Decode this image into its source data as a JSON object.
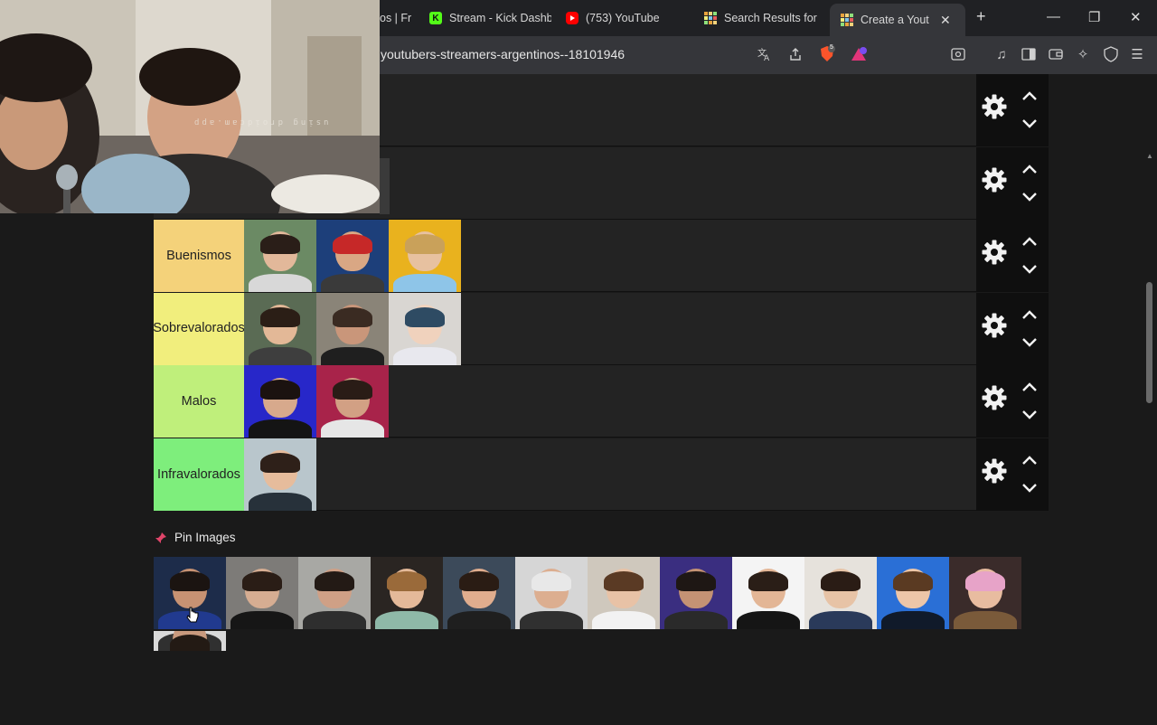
{
  "browser": {
    "tabs": [
      {
        "label": "os | Fr",
        "icon": "generic-tab-icon",
        "color": "#777777"
      },
      {
        "label": "Stream - Kick Dashb",
        "icon": "kick-icon",
        "color": "#53fc18"
      },
      {
        "label": "(753) YouTube",
        "icon": "youtube-icon",
        "color": "#ff0000"
      },
      {
        "label": "Search Results for",
        "icon": "tiermaker-icon",
        "color": "#e8a33d"
      },
      {
        "label": "Create a Youtu",
        "icon": "tiermaker-icon",
        "color": "#e8a33d"
      }
    ],
    "url": "youtubers-streamers-argentinos--18101946",
    "shields_count": "5"
  },
  "webcam": {
    "watermark": "using droidcam.app"
  },
  "tiers": [
    {
      "label": "",
      "color": "#232323",
      "items": []
    },
    {
      "label": "",
      "color": "#232323",
      "items": []
    },
    {
      "label": "Buenismos",
      "color": "#f4d27a",
      "items": [
        {
          "bg": "#6b8a64",
          "skin": "#e2b89a",
          "hair": "#2a1e18",
          "shirt": "#d8d8d8"
        },
        {
          "bg": "#1d3f7a",
          "skin": "#d9a784",
          "hair": "#c62828",
          "shirt": "#3a3a3a"
        },
        {
          "bg": "#e9b21e",
          "skin": "#e7c1a0",
          "hair": "#c9a15a",
          "shirt": "#8ec5e8"
        }
      ]
    },
    {
      "label": "Sobrevalorados",
      "color": "#f1ee7d",
      "items": [
        {
          "bg": "#5a6b54",
          "skin": "#e3b897",
          "hair": "#2b1e16",
          "shirt": "#3e3e3e"
        },
        {
          "bg": "#8a8478",
          "skin": "#c9967a",
          "hair": "#3a2b22",
          "shirt": "#1f1f1f"
        },
        {
          "bg": "#d9d6d2",
          "skin": "#f0d2bd",
          "hair": "#2e4b63",
          "shirt": "#e8e8ee"
        }
      ]
    },
    {
      "label": "Malos",
      "color": "#bfef7b",
      "items": [
        {
          "bg": "#2727c9",
          "skin": "#d7a98c",
          "hair": "#1b1210",
          "shirt": "#141414"
        },
        {
          "bg": "#a8234a",
          "skin": "#d2a084",
          "hair": "#2a1c16",
          "shirt": "#e6e6e6"
        }
      ]
    },
    {
      "label": "Infravalorados",
      "color": "#7eee7c",
      "items": [
        {
          "bg": "#b9c6cc",
          "skin": "#e6bc9c",
          "hair": "#2e2019",
          "shirt": "#27313a"
        }
      ]
    }
  ],
  "pin": {
    "label": "Pin Images",
    "icon": "pushpin-icon"
  },
  "pool": [
    {
      "bg": "#1d2c4a",
      "skin": "#c79273",
      "hair": "#1b1411",
      "shirt": "#213a8f"
    },
    {
      "bg": "#7d7b78",
      "skin": "#d6ad92",
      "hair": "#2a1d16",
      "shirt": "#161616"
    },
    {
      "bg": "#a8a8a4",
      "skin": "#cfa086",
      "hair": "#231a15",
      "shirt": "#2e2e2e"
    },
    {
      "bg": "#2a2522",
      "skin": "#e4b999",
      "hair": "#9a6a3a",
      "shirt": "#8fb9a8"
    },
    {
      "bg": "#3c4a5a",
      "skin": "#e0ad8e",
      "hair": "#2a1c14",
      "shirt": "#1f1f1f"
    },
    {
      "bg": "#d6d6d6",
      "skin": "#dcae90",
      "hair": "#e8e8e8",
      "shirt": "#303030"
    },
    {
      "bg": "#cfc8bd",
      "skin": "#e8c2a6",
      "hair": "#5a3a24",
      "shirt": "#f2f2f2"
    },
    {
      "bg": "#3a2e80",
      "skin": "#c49274",
      "hair": "#1e1714",
      "shirt": "#2a2a2a"
    },
    {
      "bg": "#f4f4f4",
      "skin": "#e3b696",
      "hair": "#2a1e17",
      "shirt": "#151515"
    },
    {
      "bg": "#e6e2dc",
      "skin": "#e7c3a6",
      "hair": "#2a1c15",
      "shirt": "#2a3a5a"
    },
    {
      "bg": "#2a6fd6",
      "skin": "#edc6a8",
      "hair": "#5a3a22",
      "shirt": "#101a2a"
    },
    {
      "bg": "#3a2b2a",
      "skin": "#e8bca0",
      "hair": "#e7a3c8",
      "shirt": "#7a5a3a"
    },
    {
      "bg": "#d9d9d9",
      "skin": "#c99a7e",
      "hair": "#231a14",
      "shirt": "#303030"
    }
  ]
}
